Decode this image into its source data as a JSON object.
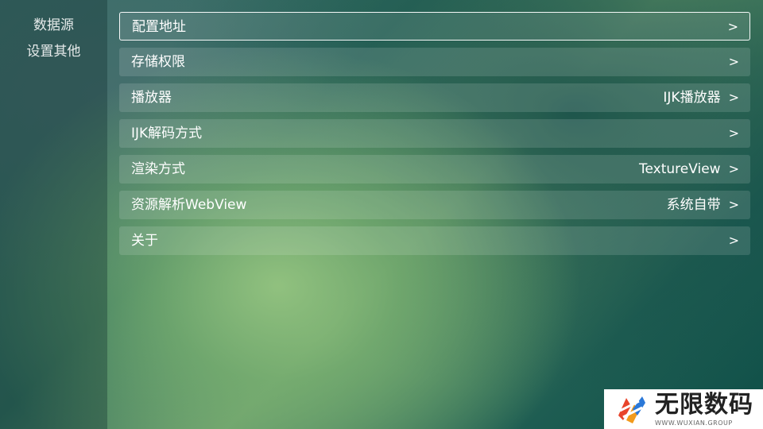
{
  "sidebar": {
    "items": [
      {
        "label": "数据源"
      },
      {
        "label": "设置其他"
      }
    ]
  },
  "settings": {
    "rows": [
      {
        "label": "配置地址",
        "value": "",
        "arrow": ">",
        "focused": true
      },
      {
        "label": "存储权限",
        "value": "",
        "arrow": ">"
      },
      {
        "label": "播放器",
        "value": "IJK播放器",
        "arrow": ">"
      },
      {
        "label": "IJK解码方式",
        "value": "",
        "arrow": ">"
      },
      {
        "label": "渲染方式",
        "value": "TextureView",
        "arrow": ">"
      },
      {
        "label": "资源解析WebView",
        "value": "系统自带",
        "arrow": ">"
      },
      {
        "label": "关于",
        "value": "",
        "arrow": ">"
      }
    ]
  },
  "watermark": {
    "title": "无限数码",
    "subtitle": "WWW.WUXIAN.GROUP"
  },
  "colors": {
    "focus_border": "#ffffff",
    "row_background": "rgba(255,255,255,0.13)",
    "sidebar_background": "rgba(15,45,45,0.35)"
  }
}
